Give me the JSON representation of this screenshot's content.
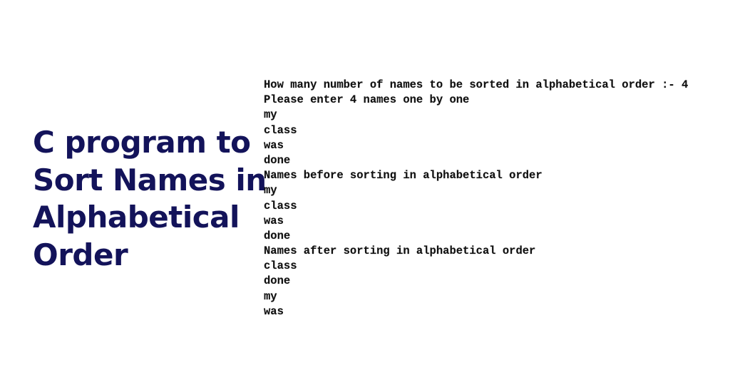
{
  "title": {
    "lines": [
      "C program to",
      "Sort Names in",
      "Alphabetical",
      "Order"
    ],
    "color": "#13135a"
  },
  "console": {
    "lines": [
      "How many number of names to be sorted in alphabetical order :- 4",
      "Please enter 4 names one by one",
      "my",
      "class",
      "was",
      "done",
      "Names before sorting in alphabetical order",
      "my",
      "class",
      "was",
      "done",
      "Names after sorting in alphabetical order",
      "class",
      "done",
      "my",
      "was"
    ]
  }
}
